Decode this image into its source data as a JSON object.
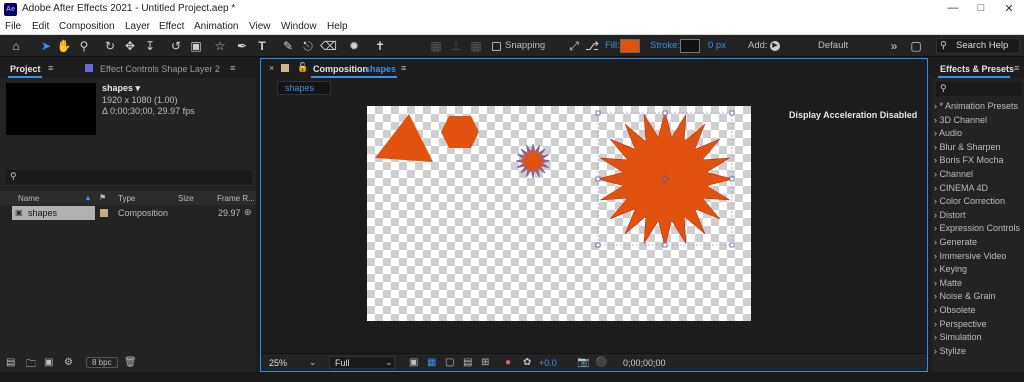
{
  "window": {
    "title": "Adobe After Effects 2021 - Untitled Project.aep *",
    "logo": "Ae"
  },
  "menu": [
    "File",
    "Edit",
    "Composition",
    "Layer",
    "Effect",
    "Animation",
    "View",
    "Window",
    "Help"
  ],
  "toolbar": {
    "snapping": "Snapping",
    "fill_label": "Fill:",
    "fill_color": "#e0520e",
    "stroke_label": "Stroke:",
    "stroke_value": "0 px",
    "add_label": "Add:",
    "workspace": "Default",
    "search_help": "Search Help"
  },
  "project": {
    "tab": "Project",
    "effect_controls_tab": "Effect Controls Shape Layer 2",
    "item_name": "shapes ▾",
    "item_resolution": "1920 x 1080 (1.00)",
    "item_duration": "Δ 0;00;30;00, 29.97 fps",
    "columns": {
      "name": "Name",
      "type": "Type",
      "size": "Size",
      "frame_rate": "Frame R..."
    },
    "row": {
      "name": "shapes",
      "type": "Composition",
      "frame_rate": "29.97"
    },
    "bpc": "8 bpc"
  },
  "composition": {
    "tab_prefix": "Composition",
    "tab_name": "shapes",
    "subtab": "shapes",
    "accel_note": "Display Acceleration Disabled",
    "zoom": "25%",
    "resolution": "Full",
    "exposure": "+0.0",
    "timecode": "0;00;00;00",
    "shape_color": "#e0520e"
  },
  "effects": {
    "tab": "Effects & Presets",
    "items": [
      "* Animation Presets",
      "3D Channel",
      "Audio",
      "Blur & Sharpen",
      "Boris FX Mocha",
      "Channel",
      "CINEMA 4D",
      "Color Correction",
      "Distort",
      "Expression Controls",
      "Generate",
      "Immersive Video",
      "Keying",
      "Matte",
      "Noise & Grain",
      "Obsolete",
      "Perspective",
      "Simulation",
      "Stylize"
    ]
  }
}
